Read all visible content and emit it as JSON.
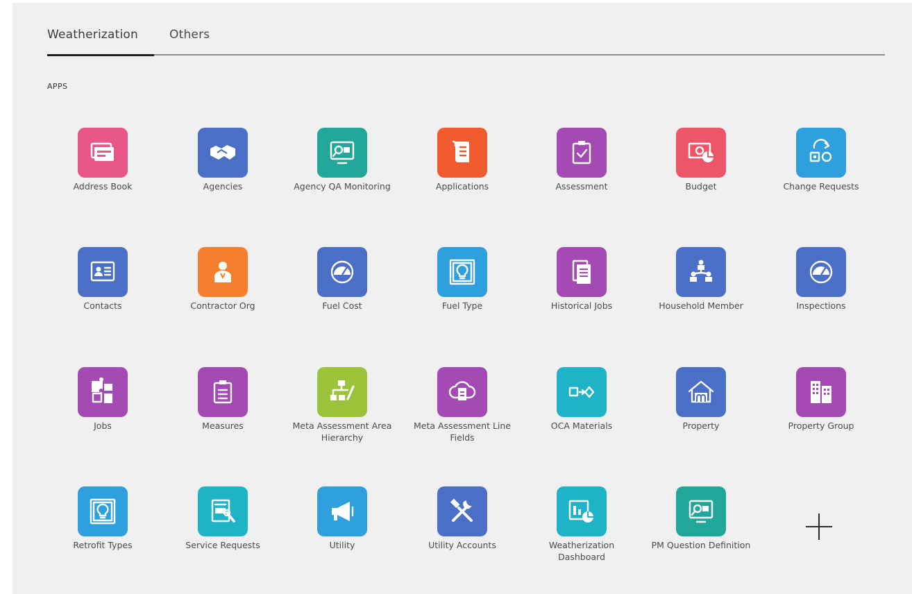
{
  "tabs": [
    {
      "label": "Weatherization",
      "active": true
    },
    {
      "label": "Others",
      "active": false
    }
  ],
  "section_title": "APPS",
  "apps": [
    {
      "label": "Address Book",
      "icon": "address-book-icon",
      "color": "#e8568a"
    },
    {
      "label": "Agencies",
      "icon": "handshake-icon",
      "color": "#4b6fc6"
    },
    {
      "label": "Agency QA Monitoring",
      "icon": "monitor-search-icon",
      "color": "#21a79a"
    },
    {
      "label": "Applications",
      "icon": "scroll-document-icon",
      "color": "#ef5a2e"
    },
    {
      "label": "Assessment",
      "icon": "clipboard-check-icon",
      "color": "#a44ab4"
    },
    {
      "label": "Budget",
      "icon": "money-chart-icon",
      "color": "#ed5668"
    },
    {
      "label": "Change Requests",
      "icon": "swap-shapes-icon",
      "color": "#2ea0de"
    },
    {
      "label": "Contacts",
      "icon": "contact-card-icon",
      "color": "#4b6fc6"
    },
    {
      "label": "Contractor Org",
      "icon": "person-badge-icon",
      "color": "#f47f2c"
    },
    {
      "label": "Fuel Cost",
      "icon": "gauge-icon",
      "color": "#4b6fc6"
    },
    {
      "label": "Fuel Type",
      "icon": "lightbulb-frame-icon",
      "color": "#2ea0de"
    },
    {
      "label": "Historical Jobs",
      "icon": "document-stack-icon",
      "color": "#a44ab4"
    },
    {
      "label": "Household Member",
      "icon": "org-people-icon",
      "color": "#4b6fc6"
    },
    {
      "label": "Inspections",
      "icon": "gauge-icon",
      "color": "#4b6fc6"
    },
    {
      "label": "Jobs",
      "icon": "puzzle-icon",
      "color": "#a44ab4"
    },
    {
      "label": "Measures",
      "icon": "clipboard-list-icon",
      "color": "#a44ab4"
    },
    {
      "label": "Meta Assessment Area Hierarchy",
      "icon": "hierarchy-edit-icon",
      "color": "#9bc33a"
    },
    {
      "label": "Meta Assessment Line Fields",
      "icon": "cloud-document-icon",
      "color": "#a44ab4"
    },
    {
      "label": "OCA Materials",
      "icon": "flow-shapes-icon",
      "color": "#1fb3c8"
    },
    {
      "label": "Property",
      "icon": "house-icon",
      "color": "#4b6fc6"
    },
    {
      "label": "Property Group",
      "icon": "buildings-icon",
      "color": "#a44ab4"
    },
    {
      "label": "Retrofit Types",
      "icon": "lightbulb-frame-icon",
      "color": "#2ea0de"
    },
    {
      "label": "Service Requests",
      "icon": "form-wrench-icon",
      "color": "#1fb3c8"
    },
    {
      "label": "Utility",
      "icon": "megaphone-icon",
      "color": "#2ea0de"
    },
    {
      "label": "Utility Accounts",
      "icon": "tools-icon",
      "color": "#4b6fc6"
    },
    {
      "label": "Weatherization Dashboard",
      "icon": "dashboard-chart-icon",
      "color": "#1fb3c8"
    },
    {
      "label": "PM Question Definition",
      "icon": "monitor-search-icon",
      "color": "#21a79a"
    }
  ],
  "add_button": {
    "icon": "plus-icon"
  }
}
